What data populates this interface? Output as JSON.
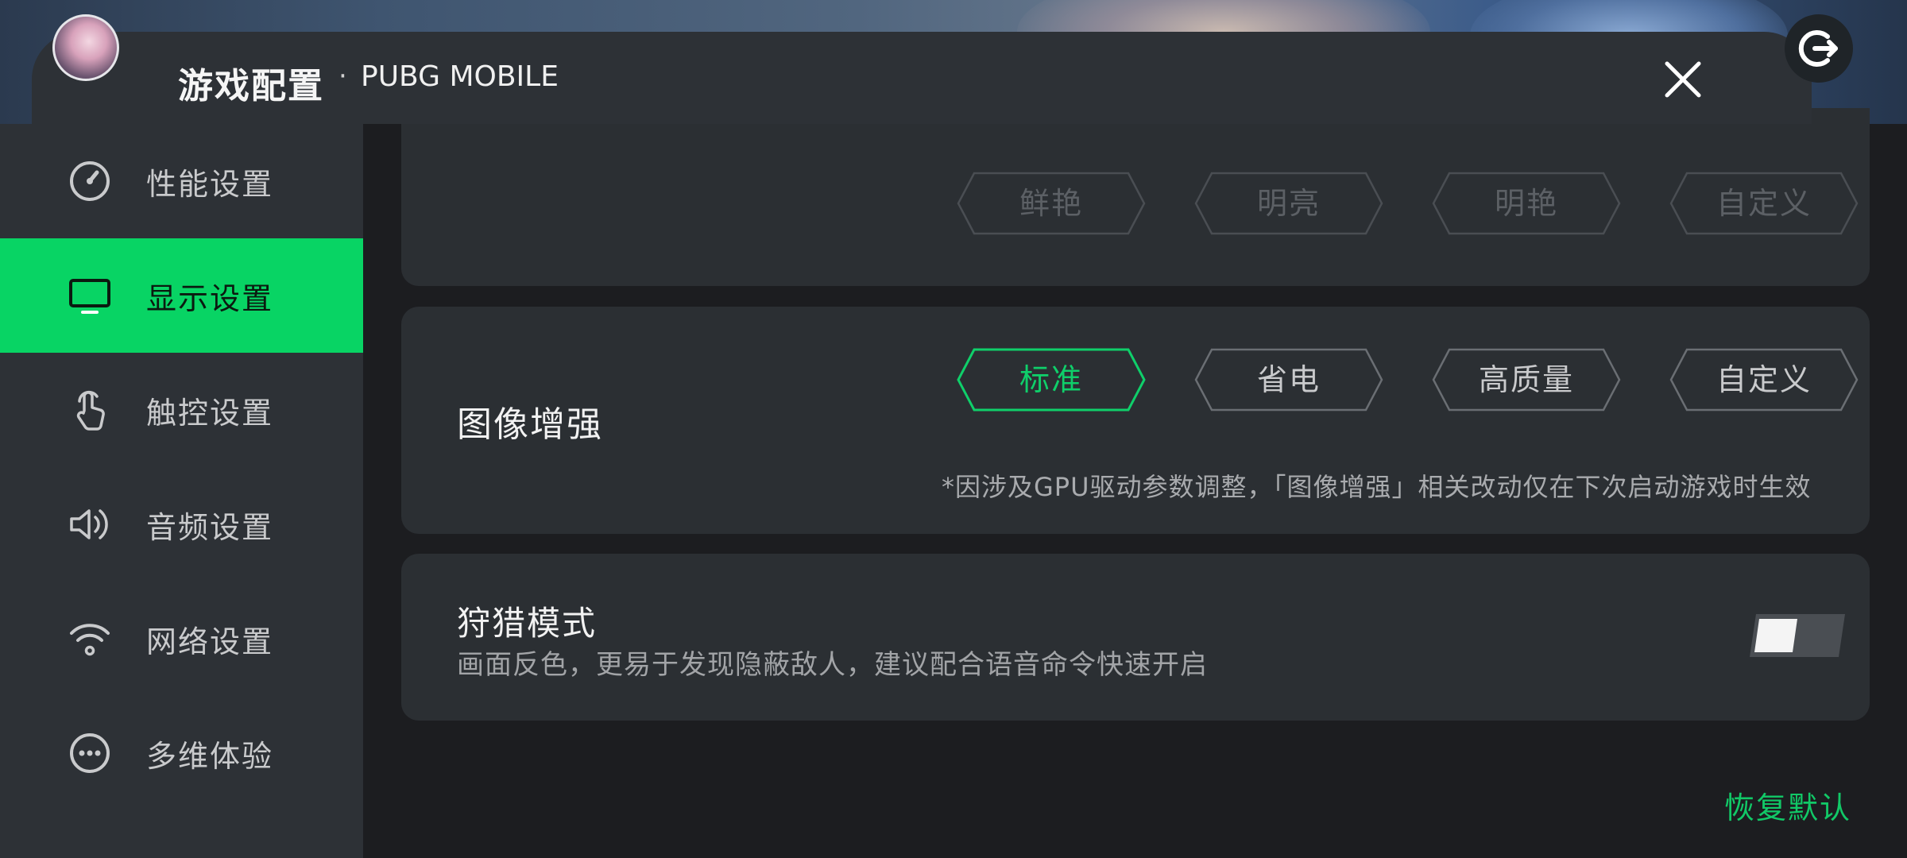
{
  "header": {
    "title": "游戏配置",
    "separator": "·",
    "game_name": "PUBG MOBILE"
  },
  "sidebar": {
    "items": [
      {
        "label": "性能设置",
        "icon": "speedometer-icon",
        "active": false
      },
      {
        "label": "显示设置",
        "icon": "monitor-icon",
        "active": true
      },
      {
        "label": "触控设置",
        "icon": "touch-hand-icon",
        "active": false
      },
      {
        "label": "音频设置",
        "icon": "speaker-icon",
        "active": false
      },
      {
        "label": "网络设置",
        "icon": "wifi-icon",
        "active": false
      },
      {
        "label": "多维体验",
        "icon": "more-dots-icon",
        "active": false
      }
    ]
  },
  "color_mode": {
    "options": [
      "鲜艳",
      "明亮",
      "明艳",
      "自定义"
    ]
  },
  "image_enhance": {
    "title": "图像增强",
    "options": [
      "标准",
      "省电",
      "高质量",
      "自定义"
    ],
    "selected": "标准",
    "note": "*因涉及GPU驱动参数调整，「图像增强」相关改动仅在下次启动游戏时生效"
  },
  "hunt_mode": {
    "title": "狩猎模式",
    "description": "画面反色，更易于发现隐蔽敌人，建议配合语音命令快速开启",
    "enabled": false
  },
  "footer": {
    "restore_label": "恢复默认"
  },
  "colors": {
    "accent": "#08d464",
    "panel": "#2d3136",
    "card": "#2b2f33",
    "background": "#1c1d20"
  }
}
